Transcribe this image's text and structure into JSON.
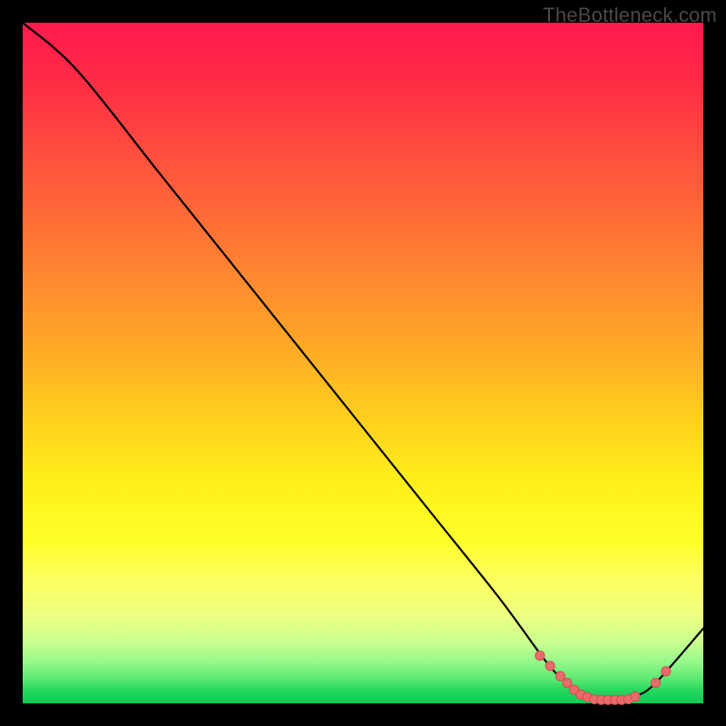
{
  "watermark": "TheBottleneck.com",
  "colors": {
    "background": "#000000",
    "line": "#000000",
    "marker_fill": "#e96a6a",
    "marker_stroke": "#cc4b4b",
    "gradient_top": "#ff1a4d",
    "gradient_bottom": "#0acc55"
  },
  "chart_data": {
    "type": "line",
    "title": "",
    "xlabel": "",
    "ylabel": "",
    "xlim": [
      0,
      100
    ],
    "ylim": [
      0,
      100
    ],
    "x": [
      0,
      8,
      20,
      30,
      40,
      50,
      60,
      70,
      77,
      80,
      83,
      85,
      88,
      90,
      93,
      100
    ],
    "y": [
      100,
      93,
      78,
      65.5,
      53,
      40.5,
      28,
      15.5,
      6,
      3,
      1,
      0.5,
      0.5,
      1,
      3,
      11
    ],
    "markers": {
      "x": [
        76,
        77.5,
        79,
        80,
        81,
        82,
        83,
        84,
        85,
        86,
        87,
        88,
        89,
        90,
        93,
        94.5
      ],
      "y": [
        7,
        5.5,
        4,
        3,
        2,
        1.3,
        0.9,
        0.6,
        0.5,
        0.5,
        0.5,
        0.5,
        0.6,
        1,
        3,
        4.7
      ]
    }
  }
}
